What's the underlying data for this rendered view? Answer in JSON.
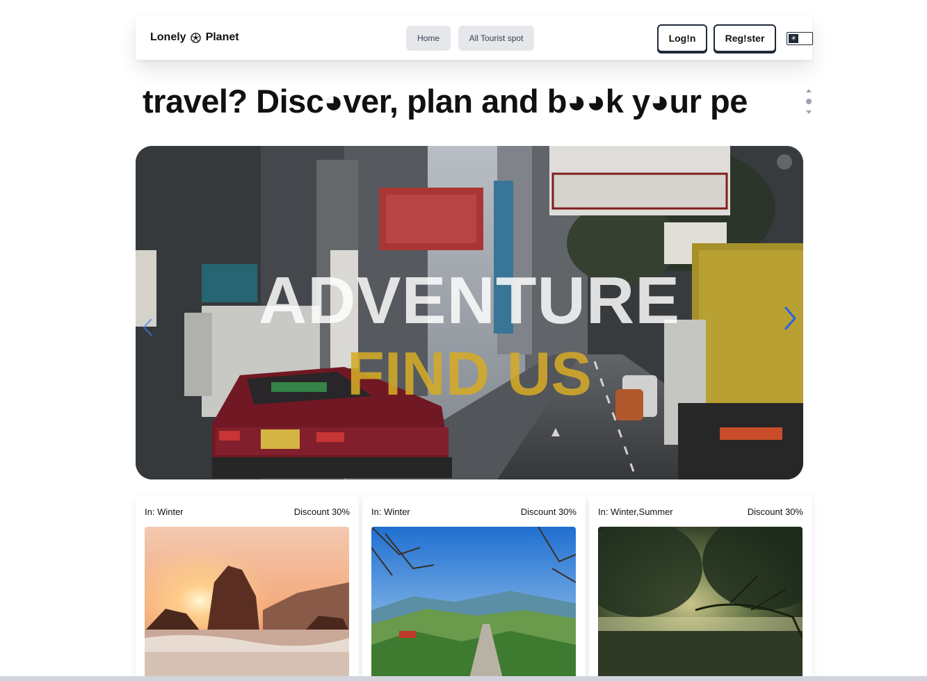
{
  "navbar": {
    "brand_left": "Lonely",
    "brand_right": "Planet",
    "links": [
      {
        "label": "Home"
      },
      {
        "label": "All Tourist spot"
      }
    ],
    "login_label": "Log!n",
    "register_label": "Reg!ster",
    "theme_icon": "sun-icon"
  },
  "marquee": {
    "text": "travel? Disc◕ver, plan and b◕◕k y◕ur pe"
  },
  "hero": {
    "title": "ADVENTURE",
    "subtitle": "FIND US",
    "subtitle_color": "#d4aa28",
    "next_arrow_color": "#2563eb"
  },
  "cards": [
    {
      "season": "In: Winter",
      "discount": "Discount 30%",
      "image": "sunset-beach-rocks"
    },
    {
      "season": "In: Winter",
      "discount": "Discount 30%",
      "image": "hill-road-valley"
    },
    {
      "season": "In: Winter,Summer",
      "discount": "Discount 30%",
      "image": "misty-forest-lake"
    }
  ]
}
